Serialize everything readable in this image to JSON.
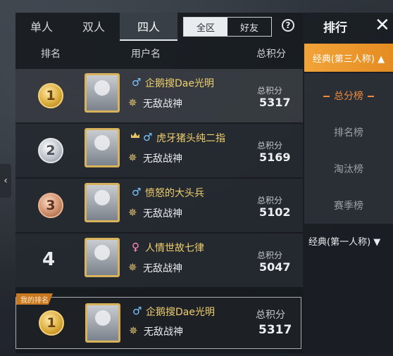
{
  "mode_tabs": [
    "单人",
    "双人",
    "四人"
  ],
  "scope": {
    "region": "全区",
    "friends": "好友"
  },
  "help_icon": "?",
  "columns": {
    "rank": "排名",
    "user": "用户名",
    "total": "总积分"
  },
  "rows": [
    {
      "rank": "1",
      "name": "企鹅搜Dae光明",
      "gender": "♂",
      "title": "无敌战神",
      "score_label": "总积分",
      "score": "5317"
    },
    {
      "rank": "2",
      "name": "虎牙猪头纯二指",
      "gender": "♂",
      "title": "无敌战神",
      "score_label": "总积分",
      "score": "5169"
    },
    {
      "rank": "3",
      "name": "愤怒的大头兵",
      "gender": "♂",
      "title": "无敌战神",
      "score_label": "总积分",
      "score": "5102"
    },
    {
      "rank": "4",
      "name": "人情世故七律",
      "gender": "♀",
      "title": "无敌战神",
      "score_label": "总积分",
      "score": "5047"
    }
  ],
  "my_rank": {
    "tag": "我的排名",
    "rank": "1",
    "name": "企鹅搜Dae光明",
    "gender": "♂",
    "title": "无敌战神",
    "score_label": "总积分",
    "score": "5317"
  },
  "sidebar": {
    "title": "排行",
    "close": "✕",
    "category_active": "经典(第三人称) ▲",
    "sub_items": [
      "总分榜",
      "排名榜",
      "淘汰榜",
      "赛季榜"
    ],
    "category_other": "经典(第一人称) ▼"
  },
  "icons": {
    "collapse": "‹",
    "dan": "✵"
  },
  "colors": {
    "accent": "#f08a3a",
    "name_gold": "#f0cf6e"
  }
}
